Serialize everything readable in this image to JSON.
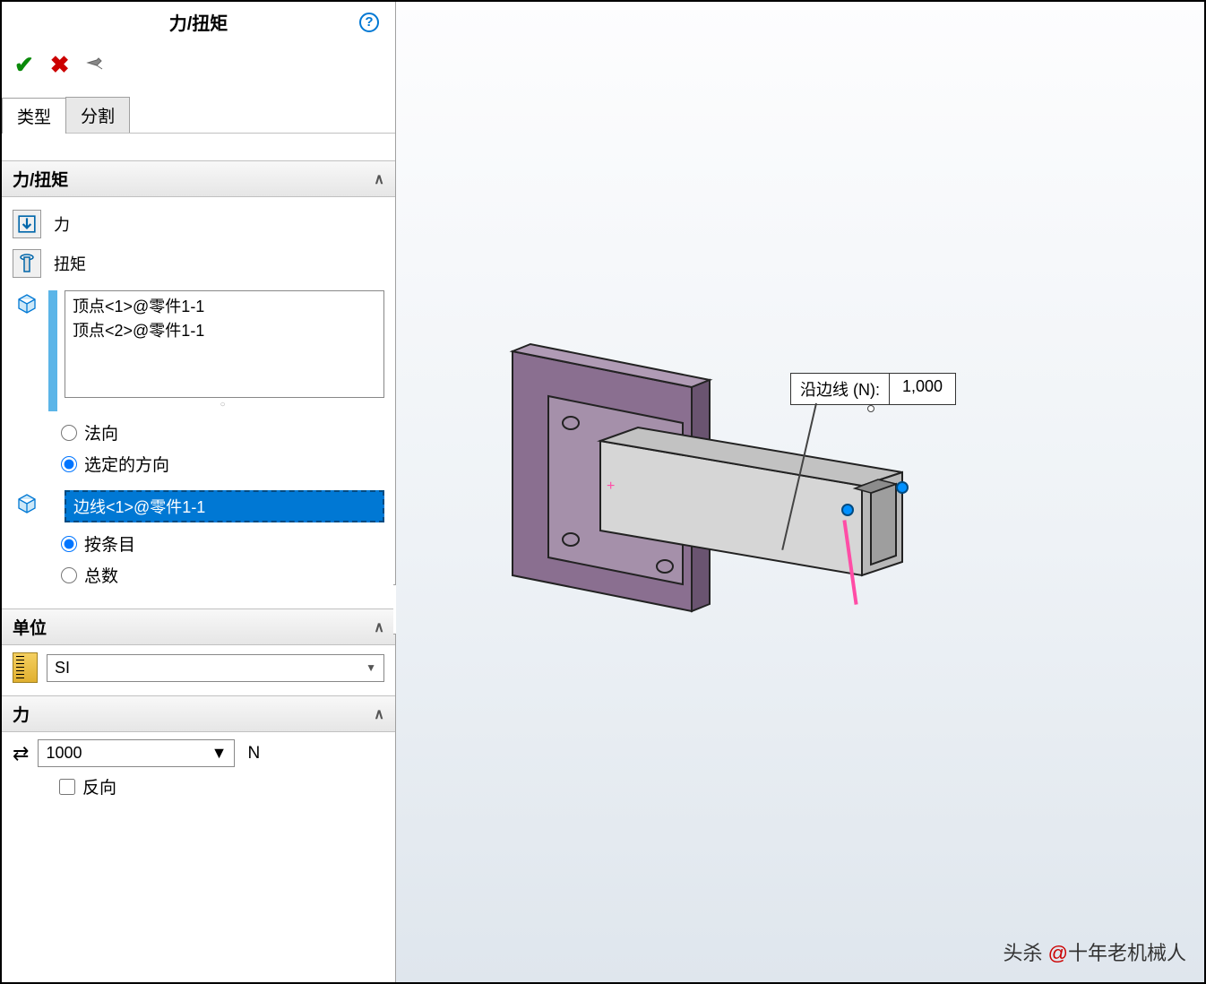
{
  "panel": {
    "title": "力/扭矩",
    "help": "?",
    "tabs": {
      "type": "类型",
      "split": "分割"
    }
  },
  "forceTorque": {
    "header": "力/扭矩",
    "forceLabel": "力",
    "torqueLabel": "扭矩",
    "selection": {
      "item1": "顶点<1>@零件1-1",
      "item2": "顶点<2>@零件1-1"
    },
    "radios": {
      "normal": "法向",
      "direction": "选定的方向",
      "perItem": "按条目",
      "total": "总数"
    },
    "edgeSelection": "边线<1>@零件1-1"
  },
  "units": {
    "header": "单位",
    "value": "SI"
  },
  "force": {
    "header": "力",
    "value": "1000",
    "unit": "N",
    "reverse": "反向"
  },
  "callout": {
    "label": "沿边线 (N):",
    "value": "1,000"
  },
  "watermark": {
    "prefix": "头杀 ",
    "at": "@",
    "name": "十年老机械人"
  }
}
